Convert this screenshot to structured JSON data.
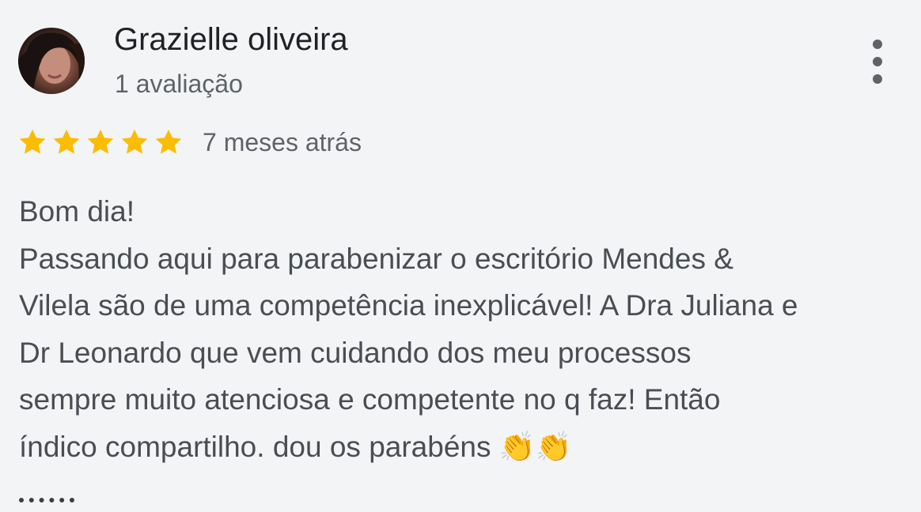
{
  "review": {
    "reviewer_name": "Grazielle oliveira",
    "review_count": "1 avaliação",
    "rating": 5,
    "rating_max": 5,
    "star_color": "#fbbc04",
    "date": "7 meses atrás",
    "text_lines": [
      "Bom dia!",
      "Passando aqui para parabenizar o escritório Mendes &",
      "Vilela são de uma competência inexplicável! A Dra Juliana e",
      "Dr Leonardo que vem cuidando dos meu processos",
      "sempre muito atenciosa e competente no q faz! Então",
      "índico compartilho. dou os parabéns"
    ],
    "text_emoji": "👏👏",
    "more_icon": "more-vert-icon",
    "avatar_icon": "profile-photo"
  }
}
